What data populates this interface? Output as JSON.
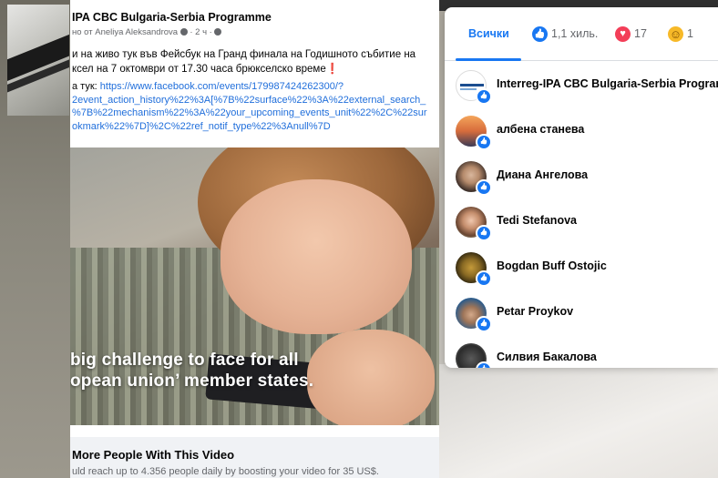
{
  "post": {
    "page_name": "IPA CBC Bulgaria-Serbia Programme",
    "subtitle_prefix": "но от Aneliya Aleksandrova",
    "subtitle_time": "· 2 ч ·",
    "text_line1": "и на живо тук във Фейсбук на Гранд финала на Годишното събитие на",
    "text_line2": "ксел на 7 октомври от 17.30 часа брюкселско време❗",
    "link_prefix": "а тук:",
    "link_text": "https://www.facebook.com/events/179987424262300/?",
    "link_line2": "2event_action_history%22%3A[%7B%22surface%22%3A%22external_search_",
    "link_line3": "%7B%22mechanism%22%3A%22your_upcoming_events_unit%22%2C%22sur",
    "link_line4": "okmark%22%7D]%2C%22ref_notif_type%22%3Anull%7D",
    "video_caption_line1": "big challenge to face for all",
    "video_caption_line2": "opean union’ member states.",
    "promo_title": "More People With This Video",
    "promo_text": "uld reach up to 4.356 people daily by boosting your video for 35 US$."
  },
  "reactions": {
    "tabs": {
      "all_label": "Всички",
      "like_count": "1,1 хиль.",
      "love_count": "17",
      "haha_count": "1"
    },
    "people": [
      {
        "name": "Interreg-IPA CBC Bulgaria-Serbia Programm",
        "avatar": "logo"
      },
      {
        "name": "албена станева",
        "avatar": "sunset"
      },
      {
        "name": "Диана Ангелова",
        "avatar": "woman-dark"
      },
      {
        "name": "Tedi Stefanova",
        "avatar": "woman-light"
      },
      {
        "name": "Bogdan Buff Ostojic",
        "avatar": "mask"
      },
      {
        "name": "Petar Proykov",
        "avatar": "man-blue"
      },
      {
        "name": "Силвия Бакалова",
        "avatar": "woman-partial"
      }
    ]
  },
  "colors": {
    "accent": "#1877f2",
    "love": "#f33e58",
    "haha": "#f7b928",
    "link": "#216fdb"
  }
}
